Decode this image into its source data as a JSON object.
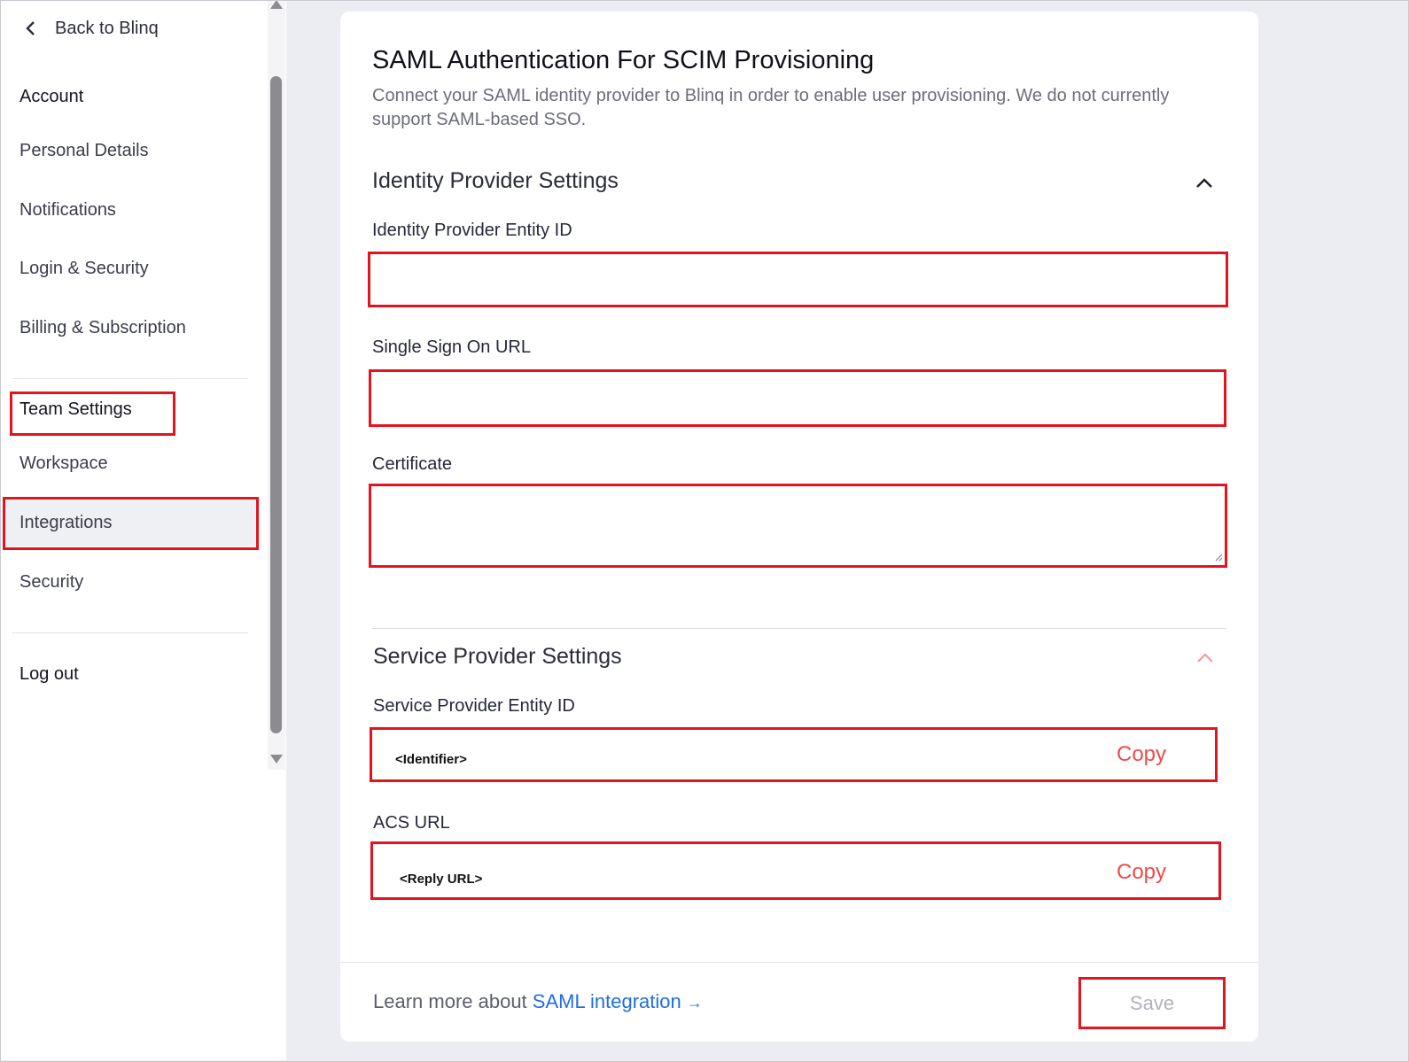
{
  "sidebar": {
    "back_label": "Back to Blinq",
    "account_heading": "Account",
    "items": [
      {
        "label": "Personal Details"
      },
      {
        "label": "Notifications"
      },
      {
        "label": "Login & Security"
      },
      {
        "label": "Billing & Subscription"
      }
    ],
    "team_heading": "Team Settings",
    "team_items": [
      {
        "label": "Workspace"
      },
      {
        "label": "Integrations",
        "selected": true
      },
      {
        "label": "Security"
      }
    ],
    "logout_label": "Log out"
  },
  "main": {
    "title": "SAML Authentication For SCIM Provisioning",
    "description": "Connect your SAML identity provider to Blinq in order to enable user provisioning. We do not currently support SAML-based SSO.",
    "idp_section": {
      "heading": "Identity Provider Settings",
      "entity_id_label": "Identity Provider Entity ID",
      "entity_id_value": "",
      "sso_url_label": "Single Sign On URL",
      "sso_url_value": "",
      "certificate_label": "Certificate",
      "certificate_value": ""
    },
    "sp_section": {
      "heading": "Service Provider Settings",
      "entity_id_label": "Service Provider Entity ID",
      "entity_id_value": "<Identifier>",
      "acs_url_label": "ACS URL",
      "acs_url_value": "<Reply URL>",
      "copy_label": "Copy"
    },
    "footer": {
      "learn_prefix": "Learn more about ",
      "learn_link": "SAML integration",
      "learn_arrow": "→",
      "save_label": "Save"
    }
  },
  "colors": {
    "highlight": "#e4141e",
    "link": "#1f6fe0",
    "copy": "#ee4a4a",
    "background": "#ecedf3"
  },
  "icons": {
    "back": "chevron-left-icon",
    "collapse": "chevron-up-icon"
  }
}
